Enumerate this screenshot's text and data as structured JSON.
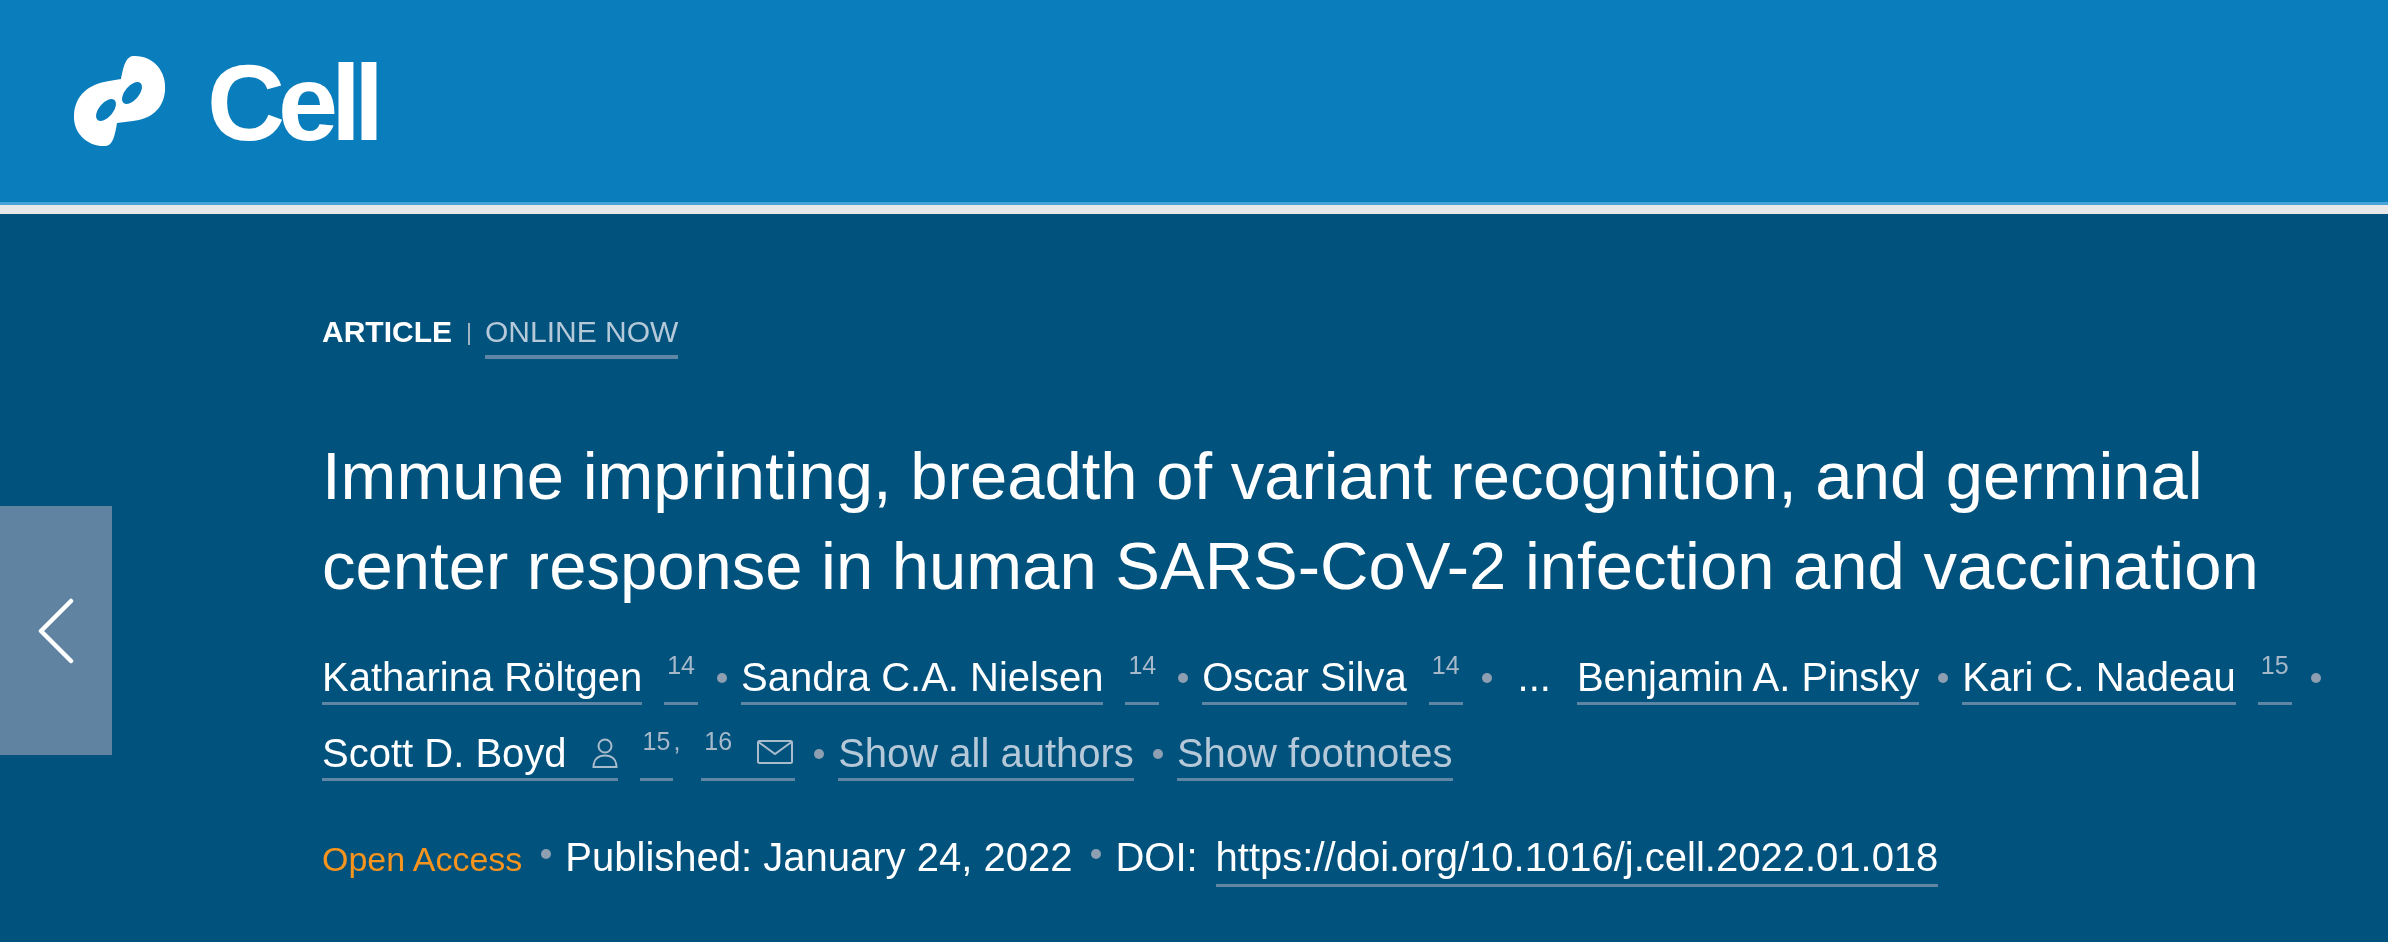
{
  "header": {
    "logo_text": "Cell"
  },
  "article_label": {
    "type": "ARTICLE",
    "status": "ONLINE NOW"
  },
  "title": "Immune imprinting, breadth of variant recognition, and germinal center response in human SARS-CoV-2 infection and vaccination",
  "byline": [
    {
      "kind": "author",
      "name": "Katharina Röltgen",
      "footnotes": [
        {
          "label": "14"
        }
      ],
      "corresponding": false,
      "email": false
    },
    {
      "kind": "author",
      "name": "Sandra C.A. Nielsen",
      "footnotes": [
        {
          "label": "14"
        }
      ],
      "corresponding": false,
      "email": false
    },
    {
      "kind": "author",
      "name": "Oscar Silva",
      "footnotes": [
        {
          "label": "14"
        }
      ],
      "corresponding": false,
      "email": false
    },
    {
      "kind": "ellipsis",
      "text": "..."
    },
    {
      "kind": "author",
      "name": "Benjamin A. Pinsky",
      "corresponding": false,
      "email": false
    },
    {
      "kind": "author",
      "name": "Kari C. Nadeau",
      "footnotes": [
        {
          "label": "15"
        }
      ],
      "corresponding": false,
      "email": false
    },
    {
      "kind": "author",
      "name": "Scott D. Boyd",
      "footnotes": [
        {
          "label": "15",
          "punct": ","
        },
        {
          "label": "16"
        }
      ],
      "corresponding": true,
      "email": true
    },
    {
      "kind": "link",
      "text": "Show all authors"
    },
    {
      "kind": "link",
      "text": "Show footnotes"
    }
  ],
  "meta": {
    "access": "Open Access",
    "published": "Published: January 24, 2022",
    "doi_label": "DOI:",
    "doi": "https://doi.org/10.1016/j.cell.2022.01.018"
  }
}
